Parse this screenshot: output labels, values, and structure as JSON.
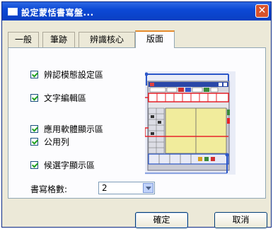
{
  "window": {
    "title": "設定蒙恬書寫盤...",
    "close_glyph": "✕"
  },
  "tabs": [
    {
      "label": "一般"
    },
    {
      "label": "筆跡"
    },
    {
      "label": "辨識核心"
    },
    {
      "label": "版面"
    }
  ],
  "active_tab": "版面",
  "options": [
    {
      "label": "辨認模態設定區",
      "checked": true
    },
    {
      "label": "文字編輯區",
      "checked": true
    },
    {
      "label": "應用軟體顯示區",
      "checked": true
    },
    {
      "label": "公用列",
      "checked": true
    },
    {
      "label": "候選字顯示區",
      "checked": true
    }
  ],
  "grid_count": {
    "label": "書寫格數:",
    "value": "2"
  },
  "buttons": {
    "ok": "確定",
    "cancel": "取消"
  },
  "colors": {
    "titlebar": "#0c49d6",
    "accent_line": "#2c57c9",
    "highlight_line": "#e8232a",
    "writing_area": "#f1ec9c"
  }
}
